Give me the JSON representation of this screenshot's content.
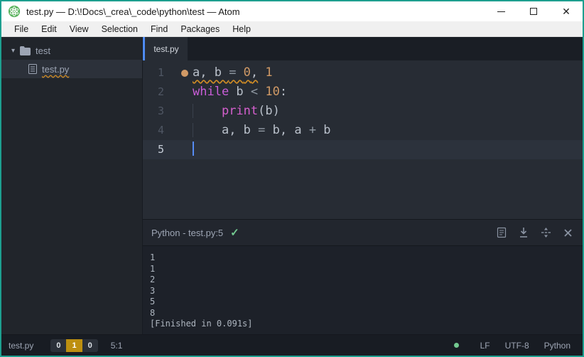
{
  "window": {
    "title": "test.py — D:\\!Docs\\_crea\\_code\\python\\test — Atom"
  },
  "menu": {
    "items": [
      "File",
      "Edit",
      "View",
      "Selection",
      "Find",
      "Packages",
      "Help"
    ]
  },
  "tree": {
    "folder": "test",
    "file": "test.py"
  },
  "tabs": [
    {
      "label": "test.py",
      "active": true
    }
  ],
  "editor": {
    "accent_color": "#4e8bf5",
    "bookmark_color": "#d19a66",
    "lint_underline_color": "#cf8c25",
    "lines": [
      {
        "number": "1",
        "bookmark": true,
        "tokens": [
          {
            "text": "a, b ",
            "cls": "var",
            "u": true
          },
          {
            "text": "= ",
            "cls": "op",
            "u": true
          },
          {
            "text": "0",
            "cls": "num",
            "u": true
          },
          {
            "text": ",",
            "cls": "var",
            "u": true
          },
          {
            "text": " ",
            "cls": "var"
          },
          {
            "text": "1",
            "cls": "num"
          }
        ]
      },
      {
        "number": "2",
        "tokens": [
          {
            "text": "while",
            "cls": "kw"
          },
          {
            "text": " b ",
            "cls": "var"
          },
          {
            "text": "<",
            "cls": "op"
          },
          {
            "text": " ",
            "cls": "var"
          },
          {
            "text": "10",
            "cls": "num"
          },
          {
            "text": ":",
            "cls": "punc"
          }
        ]
      },
      {
        "number": "3",
        "tokens": [
          {
            "text": "    ",
            "cls": "guide"
          },
          {
            "text": "print",
            "cls": "fn"
          },
          {
            "text": "(",
            "cls": "punc"
          },
          {
            "text": "b",
            "cls": "var"
          },
          {
            "text": ")",
            "cls": "punc"
          }
        ]
      },
      {
        "number": "4",
        "tokens": [
          {
            "text": "    ",
            "cls": "guide"
          },
          {
            "text": "a, b ",
            "cls": "var"
          },
          {
            "text": "= ",
            "cls": "op"
          },
          {
            "text": "b, a ",
            "cls": "var"
          },
          {
            "text": "+",
            "cls": "op"
          },
          {
            "text": " b",
            "cls": "var"
          }
        ]
      },
      {
        "number": "5",
        "current": true,
        "cursor": true,
        "tokens": []
      }
    ]
  },
  "script_panel": {
    "title": "Python - test.py:5",
    "status_check": "✓",
    "output_lines": [
      "1",
      "1",
      "2",
      "3",
      "5",
      "8",
      "[Finished in 0.091s]"
    ]
  },
  "statusbar": {
    "file": "test.py",
    "lint": {
      "errors": "0",
      "warnings": "1",
      "info": "0"
    },
    "position": "5:1",
    "line_ending": "LF",
    "encoding": "UTF-8",
    "grammar": "Python",
    "status_color": "#73c990"
  }
}
